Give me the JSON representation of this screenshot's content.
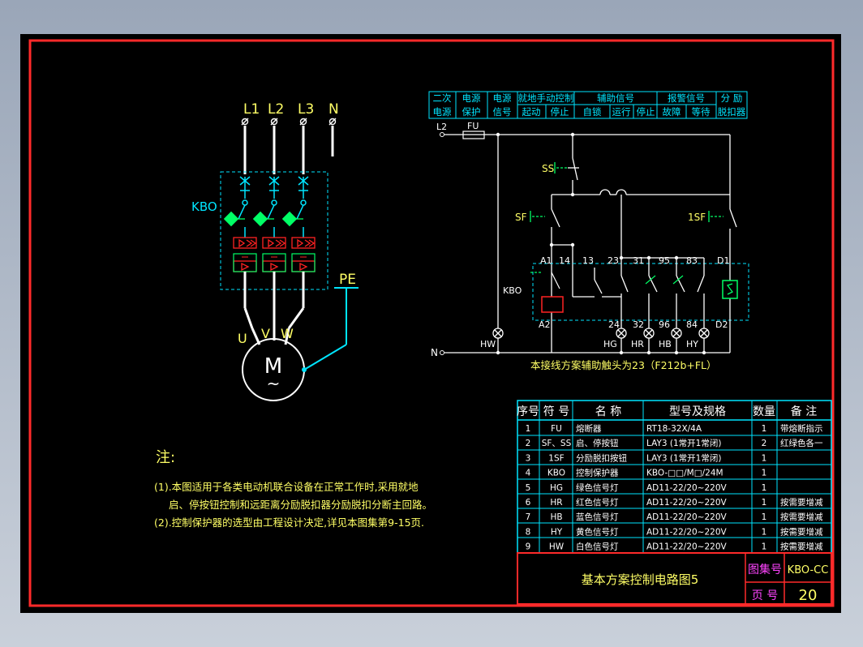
{
  "colors": {
    "background": "#000000",
    "frame": "#ff2a2a",
    "cyan": "#00e5ff",
    "white": "#ffffff",
    "yellow": "#ffff66",
    "green": "#00ff66",
    "red": "#ff2222",
    "magenta": "#ff44ff"
  },
  "main_circuit": {
    "phases": [
      "L1",
      "L2",
      "L3",
      "N"
    ],
    "device_label": "KBO",
    "pe_label": "PE",
    "motor_terminals": [
      "U",
      "V",
      "W"
    ],
    "motor_symbol": "M",
    "motor_tilde": "~"
  },
  "control_circuit": {
    "header_row1": [
      "二次",
      "电源",
      "电源",
      "就地手动控制",
      "辅助信号",
      "报警信号",
      "分 励"
    ],
    "header_row2": [
      "电源",
      "保护",
      "信号",
      "起动",
      "停止",
      "自锁",
      "运行",
      "停止",
      "故障",
      "等待",
      "脱扣器"
    ],
    "l2_label": "L2",
    "fu_label": "FU",
    "n_label": "N",
    "ss_label": "SS",
    "sf_label": "SF",
    "sf1_label": "1SF",
    "kbo_label": "KBO",
    "contacts_top": [
      "A1",
      "14",
      "13",
      "23",
      "31",
      "95",
      "83",
      "D1"
    ],
    "contacts_bottom": [
      "A2",
      "24",
      "32",
      "96",
      "84",
      "D2"
    ],
    "lamps": [
      "HW",
      "HG",
      "HR",
      "HB",
      "HY"
    ],
    "caption": "本接线方案辅助触头为23（F212b+FL）"
  },
  "notes": {
    "title": "注:",
    "line1": "(1).本图适用于各类电动机联合设备在正常工作时,采用就地",
    "line2": "启、停按钮控制和远距离分励脱扣器分励脱扣分断主回路。",
    "line3": "(2).控制保护器的选型由工程设计决定,详见本图集第9-15页."
  },
  "table": {
    "headers": [
      "序号",
      "符 号",
      "名 称",
      "型号及规格",
      "数量",
      "备 注"
    ],
    "rows": [
      [
        "1",
        "FU",
        "熔断器",
        "RT18-32X/4A",
        "1",
        "带熔断指示"
      ],
      [
        "2",
        "SF、SS",
        "启、停按钮",
        "LAY3 (1常开1常闭)",
        "2",
        "红绿色各一"
      ],
      [
        "3",
        "1SF",
        "分励脱扣按钮",
        "LAY3 (1常开1常闭)",
        "1",
        ""
      ],
      [
        "4",
        "KBO",
        "控制保护器",
        "KBO-□□/M□/24M",
        "1",
        ""
      ],
      [
        "5",
        "HG",
        "绿色信号灯",
        "AD11-22/20~220V",
        "1",
        ""
      ],
      [
        "6",
        "HR",
        "红色信号灯",
        "AD11-22/20~220V",
        "1",
        "按需要增减"
      ],
      [
        "7",
        "HB",
        "蓝色信号灯",
        "AD11-22/20~220V",
        "1",
        "按需要增减"
      ],
      [
        "8",
        "HY",
        "黄色信号灯",
        "AD11-22/20~220V",
        "1",
        "按需要增减"
      ],
      [
        "9",
        "HW",
        "白色信号灯",
        "AD11-22/20~220V",
        "1",
        "按需要增减"
      ]
    ]
  },
  "title_block": {
    "title": "基本方案控制电路图5",
    "atlas_label": "图集号",
    "atlas_value": "KBO-CC",
    "page_label": "页 号",
    "page_value": "20"
  }
}
